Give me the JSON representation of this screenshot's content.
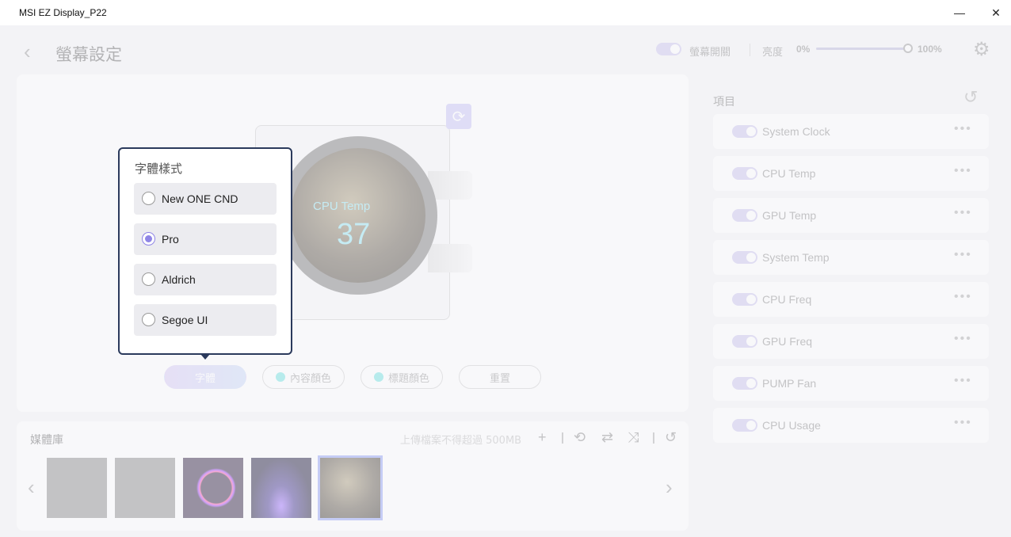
{
  "window": {
    "title": "MSI EZ Display_P22",
    "minimize": "—",
    "close": "✕"
  },
  "header": {
    "back": "‹",
    "title": "螢幕設定",
    "screen_switch_label": "螢幕開關",
    "brightness_label": "亮度",
    "brightness_min": "0%",
    "brightness_max": "100%",
    "brightness_value": 100,
    "settings_icon": "⚙"
  },
  "preview": {
    "lcd_label": "CPU Temp",
    "lcd_value": "37",
    "rotate_icon": "⟳",
    "buttons": {
      "font": "字體",
      "content_color": "內容顏色",
      "title_color": "標題顏色",
      "reset": "重置"
    }
  },
  "font_popup": {
    "title": "字體樣式",
    "options": [
      {
        "label": "New ONE CND",
        "selected": false
      },
      {
        "label": "Pro",
        "selected": true
      },
      {
        "label": "Aldrich",
        "selected": false
      },
      {
        "label": "Segoe UI",
        "selected": false
      }
    ]
  },
  "library": {
    "title": "媒體庫",
    "hint": "上傳檔案不得超過 500MB",
    "tools": {
      "add": "+",
      "loop": "⟲",
      "repeat": "⇄",
      "shuffle": "⤨",
      "reset": "↺"
    },
    "prev": "‹",
    "next": "›"
  },
  "items_panel": {
    "title": "項目",
    "reset_icon": "↺",
    "more": "•••",
    "items": [
      {
        "label": "System Clock",
        "enabled": true
      },
      {
        "label": "CPU Temp",
        "enabled": true
      },
      {
        "label": "GPU Temp",
        "enabled": true
      },
      {
        "label": "System Temp",
        "enabled": true
      },
      {
        "label": "CPU Freq",
        "enabled": true
      },
      {
        "label": "GPU Freq",
        "enabled": true
      },
      {
        "label": "PUMP Fan",
        "enabled": true
      },
      {
        "label": "CPU Usage",
        "enabled": true
      }
    ]
  },
  "colors": {
    "accent": "#8f85e6",
    "popup_border": "#2b3a5c",
    "teal": "#6ee3e0"
  }
}
